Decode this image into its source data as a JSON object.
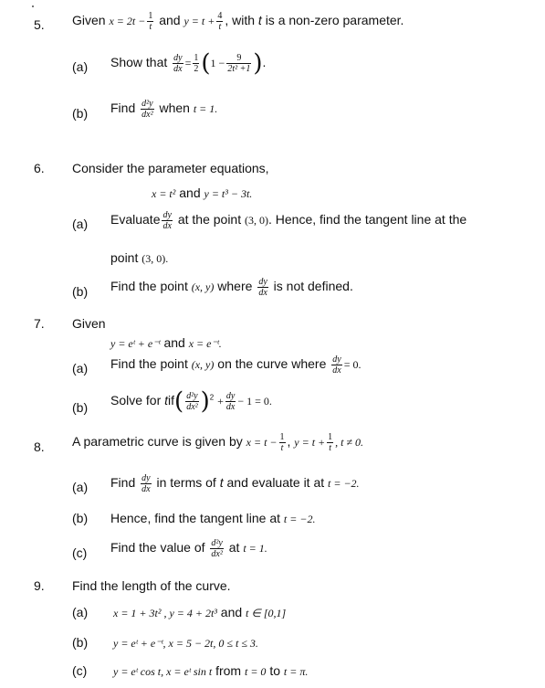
{
  "questions": [
    {
      "number": "5.",
      "stem": {
        "given": "Given",
        "x_eq": "x = 2t −",
        "x_frac": {
          "num": "1",
          "den": "t"
        },
        "and": "and",
        "y_eq": "y = t +",
        "y_frac": {
          "num": "4",
          "den": "t"
        },
        "tail": ", with",
        "t": "t",
        "tail2": "is a non-zero parameter."
      },
      "parts": [
        {
          "label": "(a)",
          "text": "Show that",
          "lhs": {
            "num": "dy",
            "den": "dx"
          },
          "eq": "=",
          "half": {
            "num": "1",
            "den": "2"
          },
          "inner": "1 −",
          "inner_frac": {
            "num": "9",
            "den": "2t² +1"
          },
          "end": "."
        },
        {
          "label": "(b)",
          "text": "Find",
          "frac": {
            "num": "d²y",
            "den": "dx²"
          },
          "when": "when",
          "cond": "t = 1."
        }
      ]
    },
    {
      "number": "6.",
      "stem": {
        "text": "Consider the parameter equations,",
        "eq1": "x = t²",
        "and": "and",
        "eq2": "y = t³ − 3t."
      },
      "parts": [
        {
          "label": "(a)",
          "text": "Evaluate",
          "frac": {
            "num": "dy",
            "den": "dx"
          },
          "after": "at the point",
          "point": "(3, 0)",
          "after2": ". Hence, find the tangent line at the",
          "line2": "point",
          "point2": "(3, 0)."
        },
        {
          "label": "(b)",
          "text": "Find the point",
          "point": "(x, y)",
          "where": "where",
          "frac": {
            "num": "dy",
            "den": "dx"
          },
          "after": "is not defined."
        }
      ]
    },
    {
      "number": "7.",
      "stem": {
        "text": "Given",
        "eq1": "y = eᵗ + e⁻ᵗ",
        "and": "and",
        "eq2": "x = e⁻ᵗ."
      },
      "parts": [
        {
          "label": "(a)",
          "text": "Find the point",
          "point": "(x, y)",
          "after": "on the curve where",
          "frac": {
            "num": "dy",
            "den": "dx"
          },
          "eq": "= 0."
        },
        {
          "label": "(b)",
          "text": "Solve for",
          "t": "t",
          "if": "if",
          "frac": {
            "num": "d²y",
            "den": "dx²"
          },
          "power": "2",
          "plus": "+",
          "frac2": {
            "num": "dy",
            "den": "dx"
          },
          "tail": "− 1 = 0."
        }
      ]
    },
    {
      "number": "8.",
      "stem": {
        "text": "A parametric curve is given by",
        "x_eq": "x = t −",
        "x_frac": {
          "num": "1",
          "den": "t"
        },
        "sep": ",",
        "y_eq": "y = t +",
        "y_frac": {
          "num": "1",
          "den": "t"
        },
        "cond": ", t ≠ 0."
      },
      "parts": [
        {
          "label": "(a)",
          "text": "Find",
          "frac": {
            "num": "dy",
            "den": "dx"
          },
          "after": "in terms of",
          "t": "t",
          "after2": "and evaluate it at",
          "cond": "t = −2."
        },
        {
          "label": "(b)",
          "text": "Hence, find the tangent line at",
          "cond": "t = −2."
        },
        {
          "label": "(c)",
          "text": "Find the value of",
          "frac": {
            "num": "d²y",
            "den": "dx²"
          },
          "at": "at",
          "cond": "t = 1."
        }
      ]
    },
    {
      "number": "9.",
      "stem": {
        "text": "Find the length of the curve."
      },
      "parts": [
        {
          "label": "(a)",
          "eq": "x = 1 + 3t² , y = 4 + 2t³",
          "and": "and",
          "cond": "t ∈ [0,1]"
        },
        {
          "label": "(b)",
          "eq": "y = eᵗ + e⁻ᵗ, x = 5 − 2t, 0 ≤ t ≤ 3."
        },
        {
          "label": "(c)",
          "eq": "y = eᵗ cos t, x = eᵗ sin t",
          "from": "from",
          "c1": "t = 0",
          "to": "to",
          "c2": "t = π."
        }
      ]
    }
  ]
}
